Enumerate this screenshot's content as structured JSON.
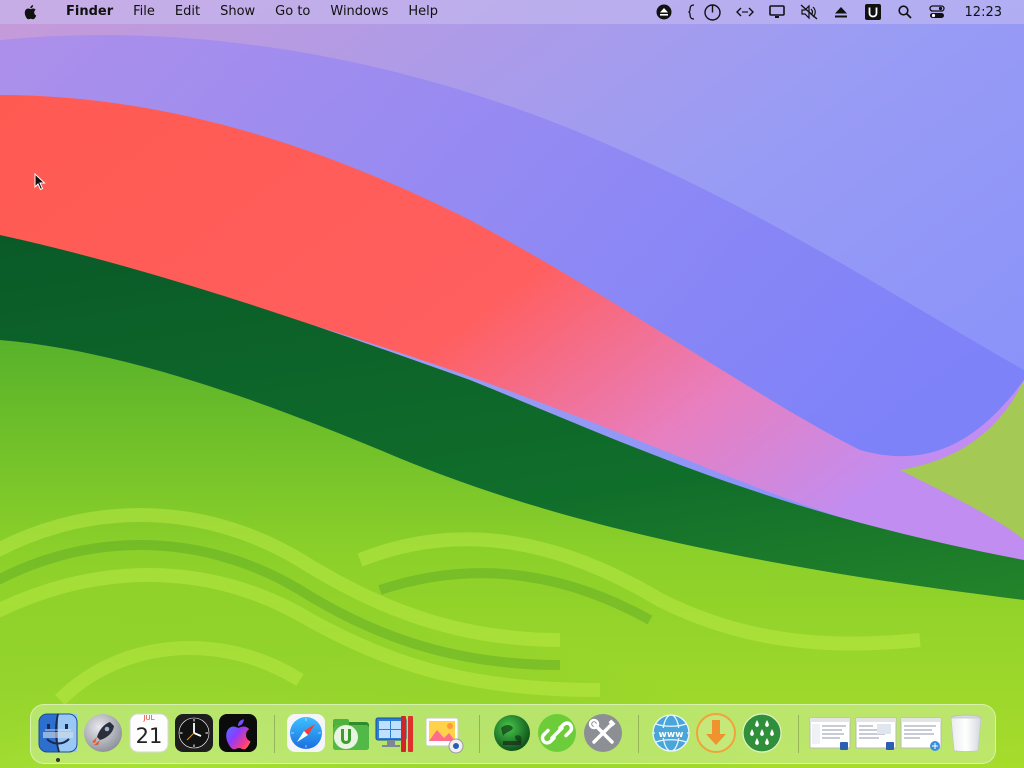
{
  "menubar": {
    "apple_icon": "apple-logo-icon",
    "items": [
      "Finder",
      "File",
      "Edit",
      "Show",
      "Go to",
      "Windows",
      "Help"
    ],
    "status_icons": [
      "eject-circle-icon",
      "bracket-icon",
      "power-circle-icon",
      "code-arrows-icon",
      "display-icon",
      "mute-icon",
      "eject-icon",
      "u-app-icon",
      "search-icon",
      "control-center-icon"
    ],
    "clock": "12:23"
  },
  "dock": {
    "apps": [
      {
        "name": "Finder",
        "icon": "finder-icon",
        "running": true
      },
      {
        "name": "Launchpad",
        "icon": "launchpad-icon",
        "running": false
      },
      {
        "name": "Calendar",
        "icon": "calendar-icon",
        "running": false,
        "month": "JUL",
        "day": "21"
      },
      {
        "name": "Clock",
        "icon": "clock-icon",
        "running": false
      },
      {
        "name": "Apple",
        "icon": "apple-gradient-icon",
        "running": false
      },
      {
        "name": "Safari",
        "icon": "safari-icon",
        "running": false
      },
      {
        "name": "uTorrent",
        "icon": "utorrent-icon",
        "running": false
      },
      {
        "name": "Windows App",
        "icon": "windows-display-icon",
        "running": false
      },
      {
        "name": "Photo Viewer",
        "icon": "photo-viewer-icon",
        "running": false
      },
      {
        "name": "Globe Green",
        "icon": "green-globe-icon",
        "running": false
      },
      {
        "name": "Link",
        "icon": "link-icon",
        "running": false
      },
      {
        "name": "Tools",
        "icon": "tools-icon",
        "running": false
      },
      {
        "name": "WWW",
        "icon": "www-globe-icon",
        "running": false
      },
      {
        "name": "Downloader",
        "icon": "download-icon",
        "running": false
      },
      {
        "name": "Drops",
        "icon": "drops-icon",
        "running": false
      },
      {
        "name": "Window 1",
        "icon": "window-thumbnail-icon",
        "running": false
      },
      {
        "name": "Window 2",
        "icon": "window-thumbnail-icon",
        "running": false
      },
      {
        "name": "Window 3",
        "icon": "window-thumbnail-icon",
        "running": false
      },
      {
        "name": "Trash",
        "icon": "trash-icon",
        "running": false
      }
    ]
  },
  "colors": {
    "menubar_bg": "#c8bef0",
    "dock_bg": "#d2f0a0",
    "wallpaper_blue": "#7a8cff",
    "wallpaper_red": "#ff5a55",
    "wallpaper_dark_green": "#0e6a2a",
    "wallpaper_lime": "#9ed628"
  }
}
